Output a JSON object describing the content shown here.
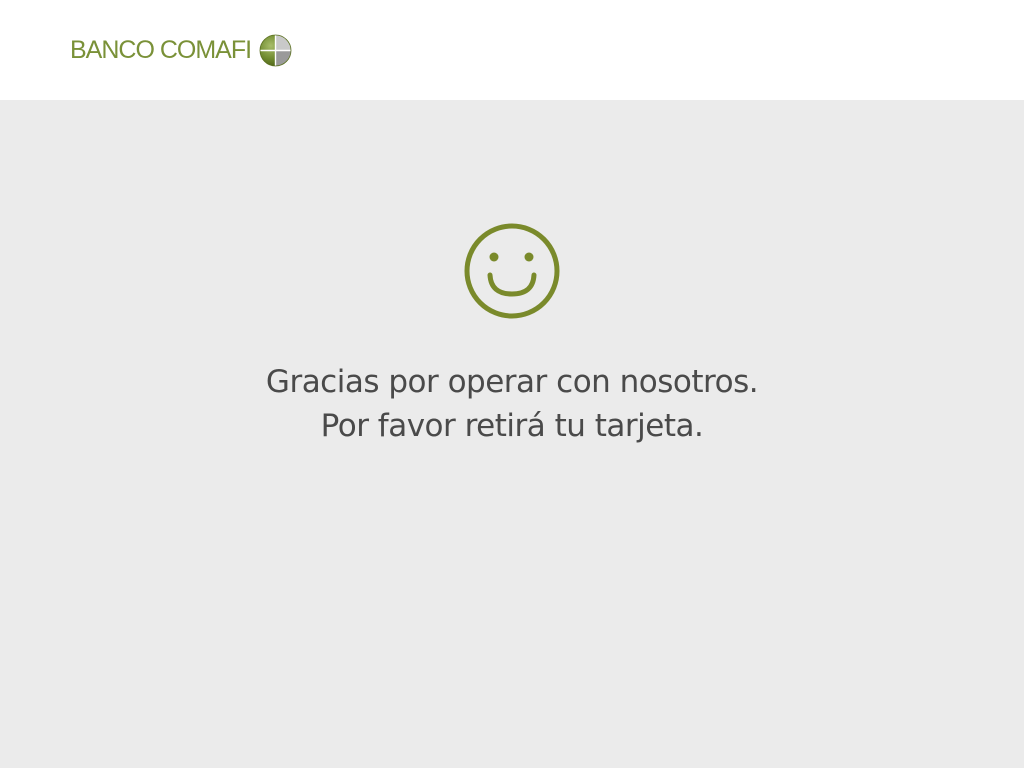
{
  "header": {
    "brand_name": "BANCO COMAFI",
    "logo_icon": "comafi-globe-logo",
    "brand_color": "#7a9138"
  },
  "main": {
    "status_icon": "smiley-face-icon",
    "icon_color": "#7a8a2b",
    "message_line_1": "Gracias por operar con nosotros.",
    "message_line_2": "Por favor retirá tu tarjeta."
  },
  "colors": {
    "background": "#ebebeb",
    "header_background": "#ffffff",
    "text": "#4a4a4a"
  }
}
